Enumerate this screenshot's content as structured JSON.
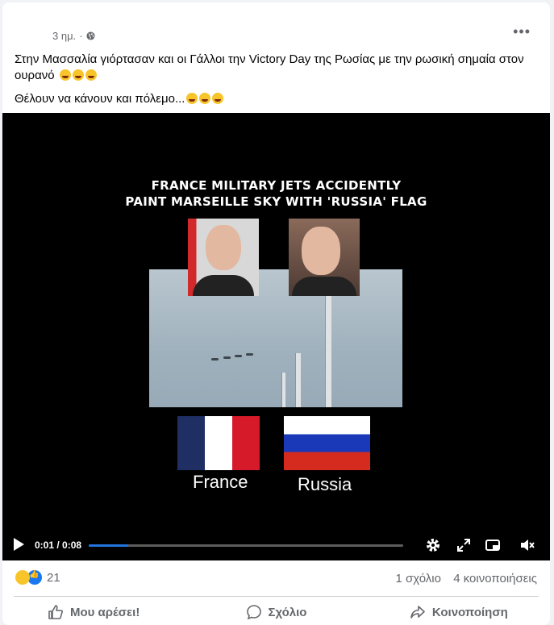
{
  "post": {
    "timestamp": "3 ημ.",
    "separator": "·",
    "text_line1": "Στην Μασσαλία γιόρτασαν και οι Γάλλοι την Victory Day της Ρωσίας με την ρωσική σημαία στον ουρανό",
    "text_line2": "Θέλουν να κάνουν και πόλεμο..."
  },
  "video": {
    "headline_line1": "FRANCE MILITARY JETS ACCIDENTLY",
    "headline_line2": "PAINT MARSEILLE SKY WITH 'RUSSIA' FLAG",
    "label_france": "France",
    "label_russia": "Russia",
    "time": "0:01 / 0:08",
    "progress": 0.125
  },
  "stats": {
    "reactions_count": "21",
    "comments": "1 σχόλιο",
    "shares": "4 κοινοποιήσεις"
  },
  "actions": {
    "like": "Μου αρέσει!",
    "comment": "Σχόλιο",
    "share": "Κοινοποίηση"
  },
  "colors": {
    "accent": "#2374e1",
    "like_blue": "#1877f2",
    "haha_yellow": "#f7c42a",
    "muted_text": "#65676b"
  }
}
